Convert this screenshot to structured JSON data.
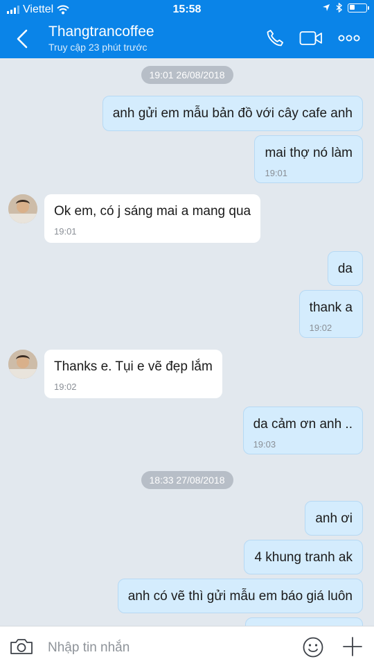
{
  "status_bar": {
    "carrier": "Viettel",
    "time": "15:58"
  },
  "header": {
    "contact_name": "Thangtrancoffee",
    "contact_status": "Truy cập 23 phút trước"
  },
  "separators": [
    "19:01 26/08/2018",
    "18:33 27/08/2018"
  ],
  "messages": [
    {
      "dir": "out",
      "text": "anh gửi em mẫu bản đồ với cây cafe anh",
      "time": ""
    },
    {
      "dir": "out",
      "text": "mai thợ nó làm",
      "time": "19:01"
    },
    {
      "dir": "in",
      "text": "Ok em, có j sáng mai a mang qua",
      "time": "19:01"
    },
    {
      "dir": "out",
      "text": "da",
      "time": ""
    },
    {
      "dir": "out",
      "text": "thank a",
      "time": "19:02"
    },
    {
      "dir": "in",
      "text": "Thanks e. Tụi e vẽ đẹp lắm",
      "time": "19:02"
    },
    {
      "dir": "out",
      "text": "da cảm ơn anh ..",
      "time": "19:03"
    },
    {
      "dir": "out",
      "text": "anh ơi",
      "time": ""
    },
    {
      "dir": "out",
      "text": "4 khung tranh ak",
      "time": ""
    },
    {
      "dir": "out",
      "text": "anh có vẽ thì gửi mẫu em báo giá luôn",
      "time": ""
    }
  ],
  "input": {
    "placeholder": "Nhập tin nhắn"
  },
  "icons": [
    "back-icon",
    "phone-icon",
    "video-call-icon",
    "more-icon",
    "camera-icon",
    "emoji-icon",
    "plus-icon"
  ],
  "colors": {
    "accent": "#0a84e8",
    "outgoing_bubble": "#d4ecfd",
    "incoming_bubble": "#ffffff",
    "background": "#e2e8ee"
  }
}
